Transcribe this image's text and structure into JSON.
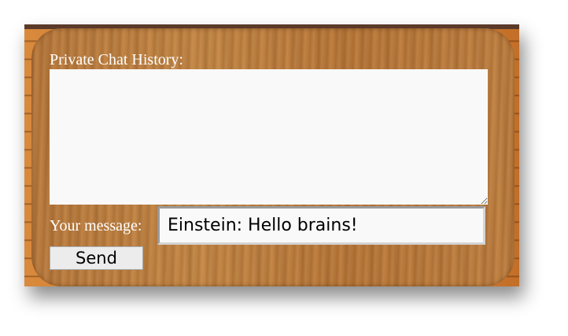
{
  "chat": {
    "history_label": "Private Chat History:",
    "history_content": "",
    "message_label": "Your message:",
    "message_value": "Einstein: Hello brains!",
    "send_label": "Send"
  },
  "colors": {
    "label_text": "#ffffff",
    "wood_panel": "#c48746",
    "input_background": "#f9f9f9",
    "button_background": "#ececec"
  }
}
